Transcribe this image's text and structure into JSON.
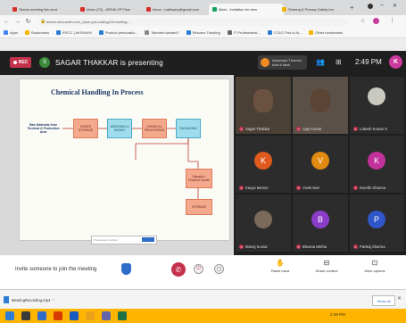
{
  "browser": {
    "tabs": [
      {
        "label": "Teams meeting link sent",
        "color": "#d93025"
      },
      {
        "label": "Inbox (73) - ARIVA VP Flow",
        "color": "#d93025"
      },
      {
        "label": "Inbox - babhyam@gmail.com",
        "color": "#d93025"
      },
      {
        "label": "Meet - Invitation for dem",
        "color": "#1aa260"
      },
      {
        "label": "Sharing & Privacy Safety Ins",
        "color": "#f4b400"
      }
    ],
    "url": "teams.microsoft.com/_#/pre-join-calling/19:meeting...",
    "bookmarks": [
      "Apps",
      "Bookmarks",
      "ERCC | AKSHAYA",
      "Product personaliz...",
      "Talented wanted?",
      "Resume Tracking",
      "IT Professional...",
      "IT-D/2 This is At...",
      "Other bookmarks"
    ]
  },
  "meeting": {
    "rec_label": "REC",
    "presenter_initial": "S",
    "presenter_text": "SAGAR THAKKAR is presenting",
    "take_back": {
      "line1": "Ayswarya Thomas",
      "line2": "took it back"
    },
    "timer": "2:49 PM",
    "user_initial": "K"
  },
  "slide": {
    "title": "Chemical Handling In Process",
    "nodes": [
      {
        "text": "Raw Materials from Terminal & Production Area",
        "style": "plain"
      },
      {
        "text": "INTAKE STORAGE",
        "style": "salmon"
      },
      {
        "text": "WEIGHING & MIXING",
        "style": "cyan"
      },
      {
        "text": "CHEMICAL PROCESSING",
        "style": "salmon"
      },
      {
        "text": "PACKAGING",
        "style": "cyan"
      },
      {
        "text": "Dispatch / Finished Goods",
        "style": "salmon"
      },
      {
        "text": "STORAGE",
        "style": "salmon"
      }
    ],
    "footer_text": "Presentation toolbar"
  },
  "participants": [
    {
      "name": "Sagar Thakkar",
      "kind": "video"
    },
    {
      "name": "Ajay Kumar",
      "kind": "video"
    },
    {
      "name": "Lokesh Kumar S",
      "kind": "photo"
    },
    {
      "name": "Kavya Menon",
      "initial": "K",
      "color": "#e05a1e"
    },
    {
      "name": "Vivek Nair",
      "initial": "V",
      "color": "#e08a12"
    },
    {
      "name": "Keerthi Sharma",
      "initial": "K",
      "color": "#c2309a"
    },
    {
      "name": "Manoj Kumar",
      "kind": "photo"
    },
    {
      "name": "Bhavna Mehta",
      "initial": "B",
      "color": "#8a3dc9"
    },
    {
      "name": "Pankaj Sharma",
      "initial": "P",
      "color": "#2f57c9"
    }
  ],
  "controls": {
    "status_text": "Invite someone to join the meeting",
    "raise_hand": "Raise hand",
    "more_options": "More options",
    "share_tray": "Share content",
    "leave_label": "Leave"
  },
  "download": {
    "file": "MeetingRecording.mp4",
    "show_all": "Show all"
  },
  "taskbar": {
    "clock": "2:49 PM"
  }
}
